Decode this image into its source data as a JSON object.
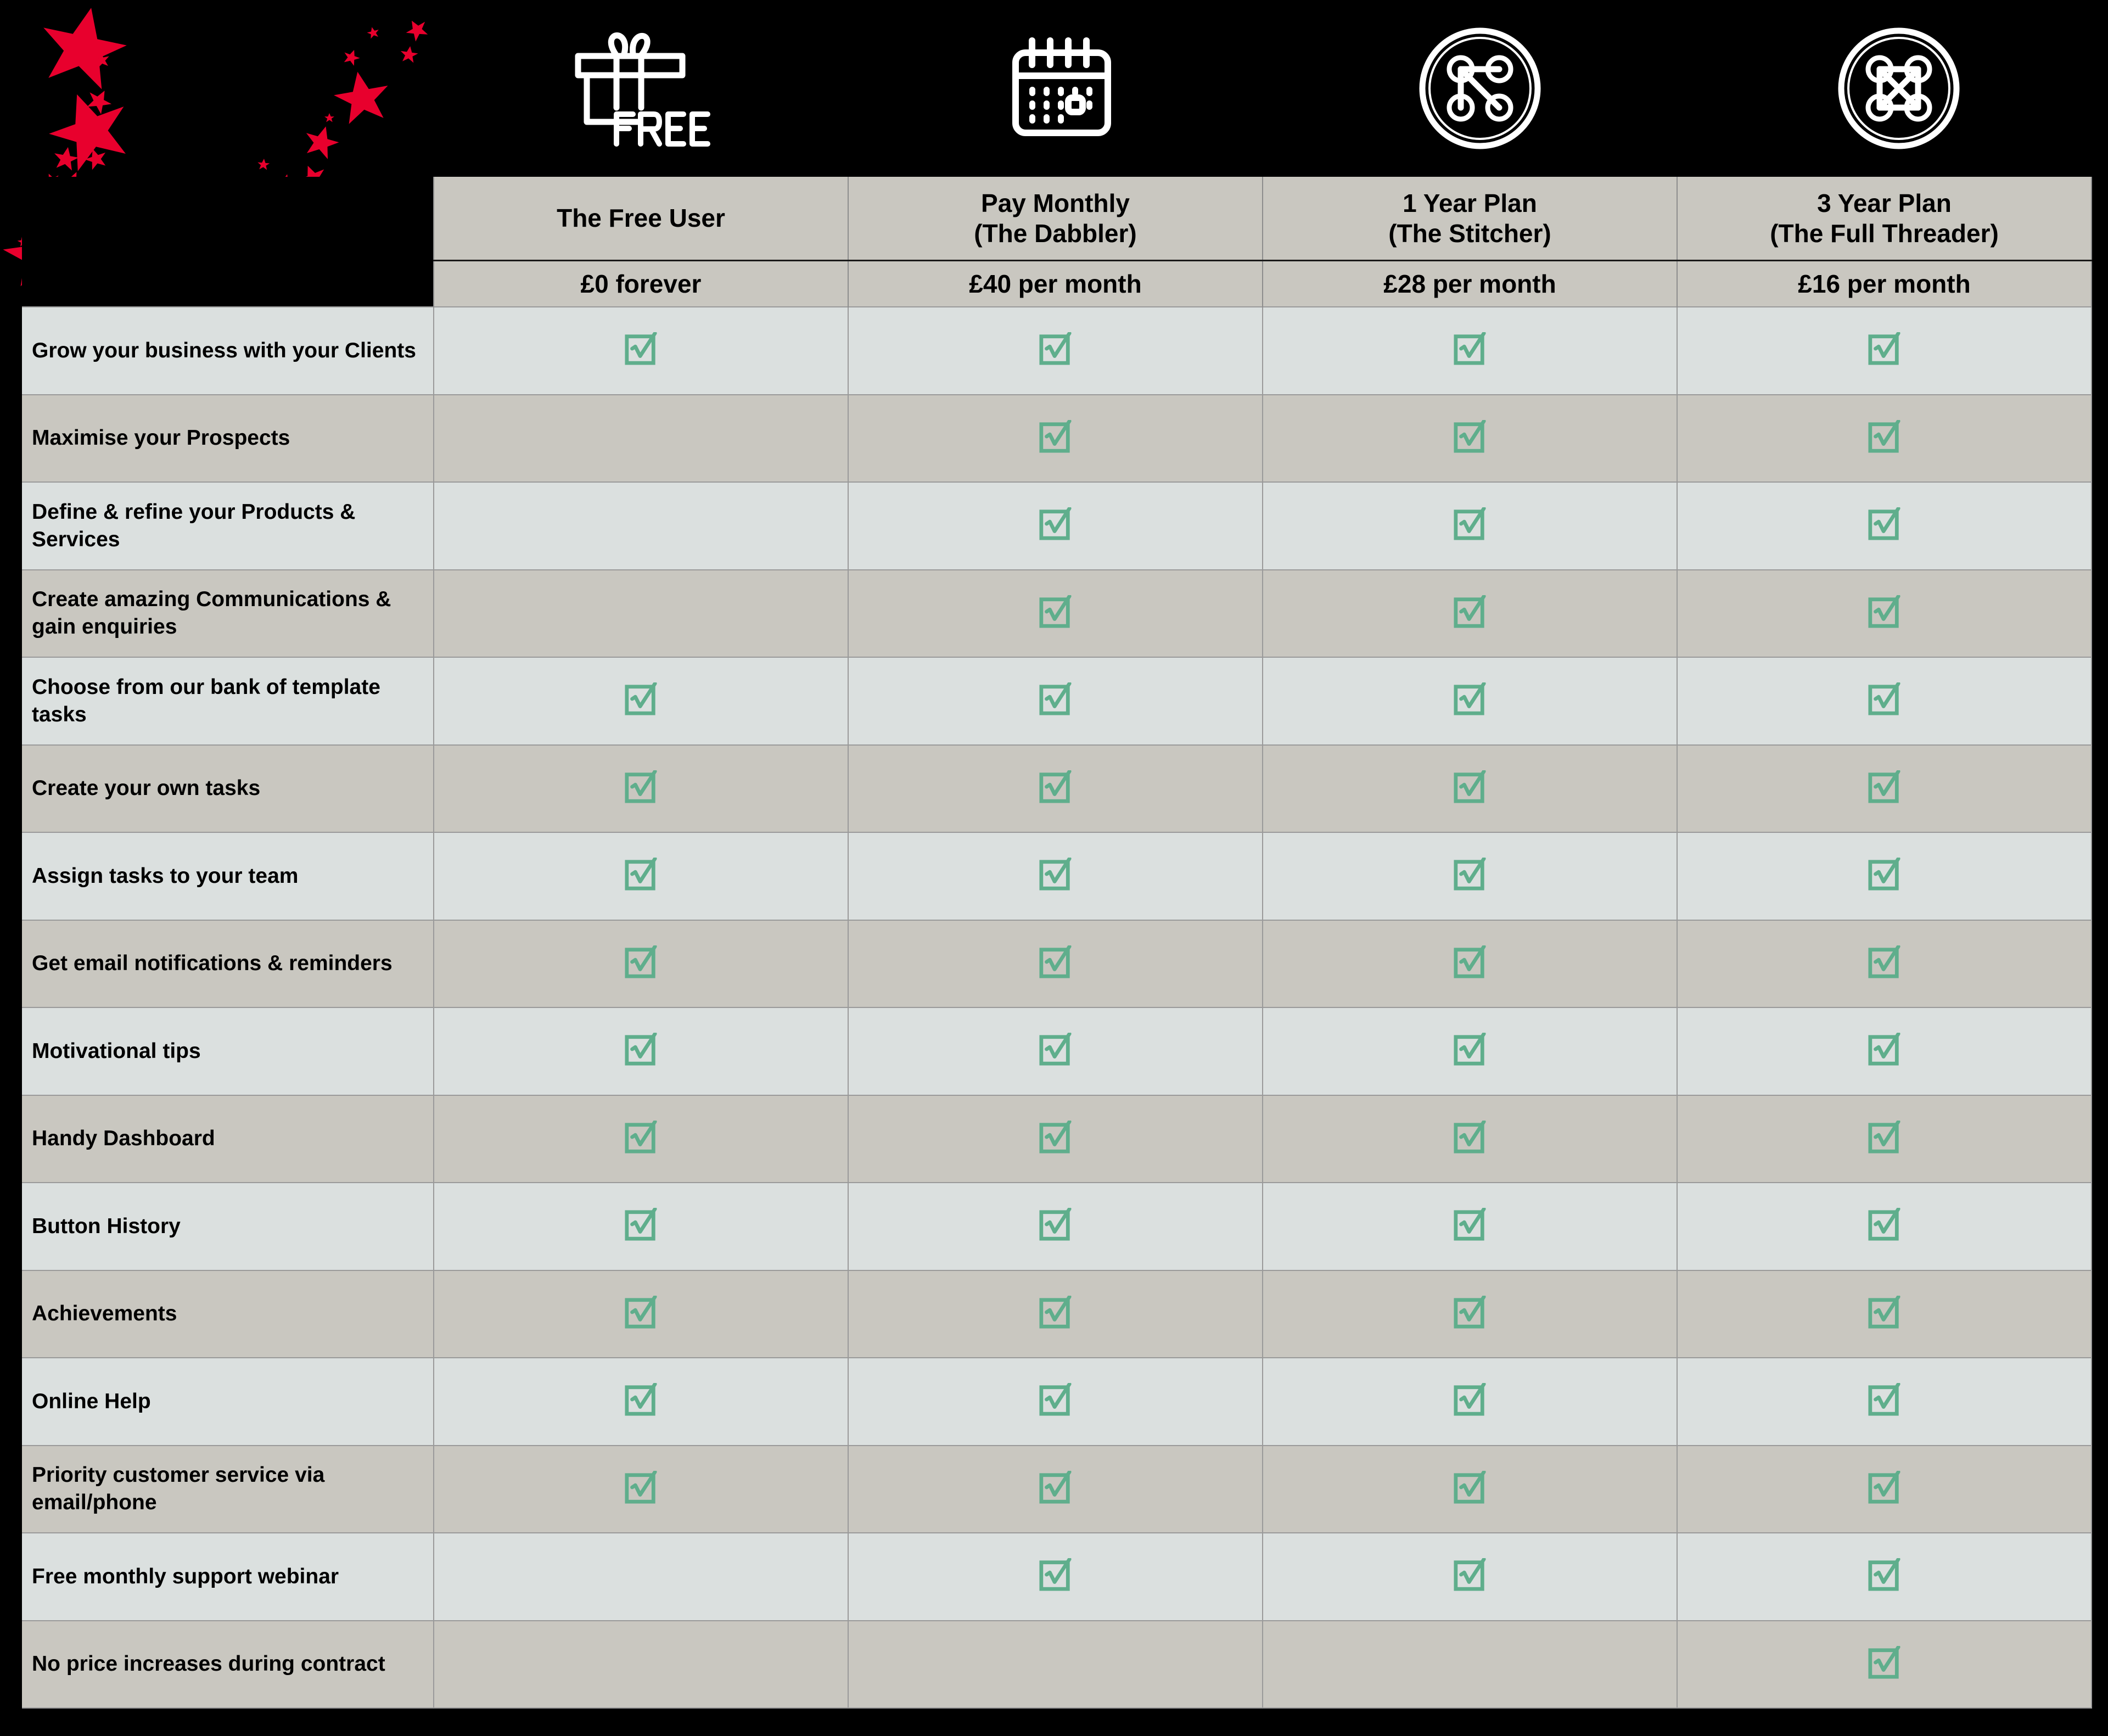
{
  "theme": {
    "background": "#000000",
    "star_color": "#E8002D",
    "header_band": "#C9C7C0",
    "row_light": "#DBE0DF",
    "row_dark": "#C9C7C0",
    "grid_line": "#9A9A9A",
    "tick_green": "#5FAE8C",
    "icon_white": "#FFFFFF"
  },
  "decoration": {
    "starfield_name": "red-stars-swoosh"
  },
  "header_icons": [
    {
      "name": "gift-free-icon",
      "label": "FREE"
    },
    {
      "name": "calendar-icon",
      "label": ""
    },
    {
      "name": "network-path-icon",
      "label": ""
    },
    {
      "name": "network-mesh-icon",
      "label": ""
    }
  ],
  "plans": [
    {
      "name": "The Free User",
      "subtitle": "",
      "price": "£0 forever"
    },
    {
      "name": "Pay Monthly",
      "subtitle": "(The Dabbler)",
      "price": "£40 per month"
    },
    {
      "name": "1 Year Plan",
      "subtitle": "(The Stitcher)",
      "price": "£28 per month"
    },
    {
      "name": "3 Year Plan",
      "subtitle": "(The Full Threader)",
      "price": "£16 per month"
    }
  ],
  "features": [
    {
      "label": "Grow your business with your Clients",
      "included": [
        true,
        true,
        true,
        true
      ]
    },
    {
      "label": "Maximise your Prospects",
      "included": [
        false,
        true,
        true,
        true
      ]
    },
    {
      "label": "Define & refine your Products & Services",
      "included": [
        false,
        true,
        true,
        true
      ]
    },
    {
      "label": "Create amazing Communications & gain enquiries",
      "included": [
        false,
        true,
        true,
        true
      ]
    },
    {
      "label": "Choose from our bank of template tasks",
      "included": [
        true,
        true,
        true,
        true
      ]
    },
    {
      "label": "Create your own tasks",
      "included": [
        true,
        true,
        true,
        true
      ]
    },
    {
      "label": "Assign tasks to your team",
      "included": [
        true,
        true,
        true,
        true
      ]
    },
    {
      "label": "Get email notifications & reminders",
      "included": [
        true,
        true,
        true,
        true
      ]
    },
    {
      "label": "Motivational tips",
      "included": [
        true,
        true,
        true,
        true
      ]
    },
    {
      "label": "Handy Dashboard",
      "included": [
        true,
        true,
        true,
        true
      ]
    },
    {
      "label": "Button History",
      "included": [
        true,
        true,
        true,
        true
      ]
    },
    {
      "label": "Achievements",
      "included": [
        true,
        true,
        true,
        true
      ]
    },
    {
      "label": "Online Help",
      "included": [
        true,
        true,
        true,
        true
      ]
    },
    {
      "label": "Priority customer service via email/phone",
      "included": [
        true,
        true,
        true,
        true
      ]
    },
    {
      "label": "Free monthly support webinar",
      "included": [
        false,
        true,
        true,
        true
      ]
    },
    {
      "label": "No price increases during contract",
      "included": [
        false,
        false,
        false,
        true
      ]
    }
  ],
  "tick_glyph": "☑"
}
